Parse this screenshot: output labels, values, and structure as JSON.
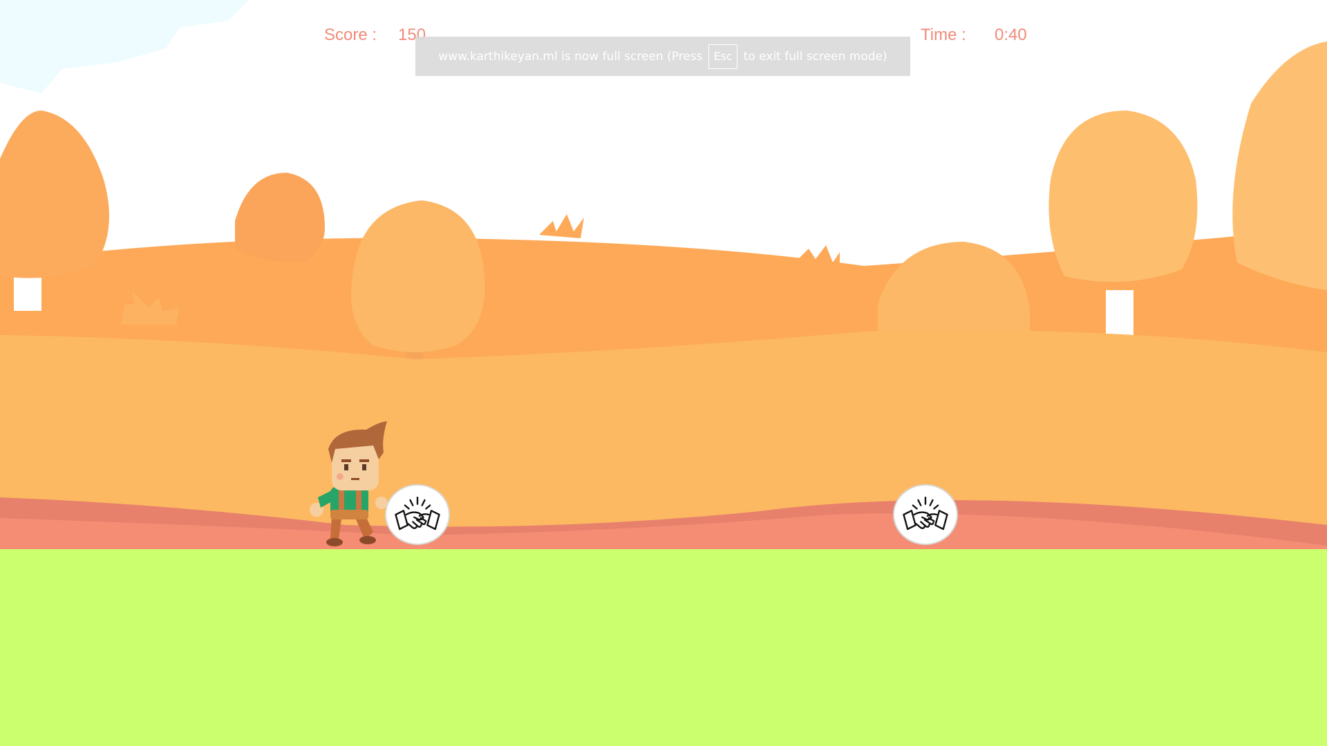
{
  "hud": {
    "score_label": "Score :",
    "score_value": "150",
    "time_label": "Time :",
    "time_value": "0:40"
  },
  "fullscreen_notice": {
    "before": "www.karthikeyan.ml is now full screen (Press",
    "key": "Esc",
    "after": "to exit full screen mode)"
  },
  "tokens": [
    {
      "icon": "handshake-icon"
    },
    {
      "icon": "handshake-icon"
    }
  ],
  "player": {
    "icon": "runner-character"
  },
  "colors": {
    "hud_text": "#f18a7a",
    "sky": "#ffffff",
    "far_hills": "#fdb062",
    "near_hills": "#fdbb66",
    "ground_strip": "#f18a6c",
    "grass": "#ccff6e",
    "banner_bg": "#dadada"
  }
}
